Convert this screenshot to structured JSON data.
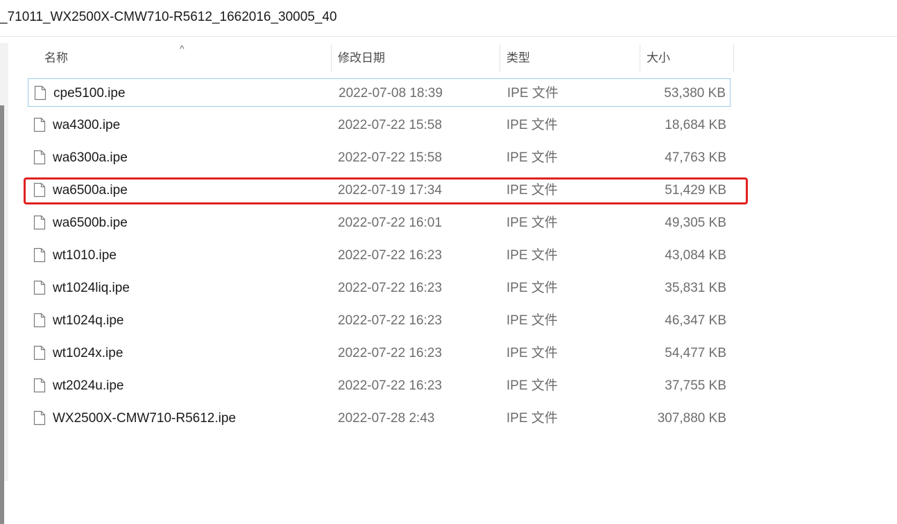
{
  "path": {
    "text": "_71011_WX2500X-CMW710-R5612_1662016_30005_40"
  },
  "columns": {
    "name": "名称",
    "date": "修改日期",
    "type": "类型",
    "size": "大小"
  },
  "sort_indicator": "^",
  "files": [
    {
      "name": "cpe5100.ipe",
      "date": "2022-07-08 18:39",
      "type": "IPE 文件",
      "size": "53,380 KB"
    },
    {
      "name": "wa4300.ipe",
      "date": "2022-07-22 15:58",
      "type": "IPE 文件",
      "size": "18,684 KB"
    },
    {
      "name": "wa6300a.ipe",
      "date": "2022-07-22 15:58",
      "type": "IPE 文件",
      "size": "47,763 KB"
    },
    {
      "name": "wa6500a.ipe",
      "date": "2022-07-19 17:34",
      "type": "IPE 文件",
      "size": "51,429 KB"
    },
    {
      "name": "wa6500b.ipe",
      "date": "2022-07-22 16:01",
      "type": "IPE 文件",
      "size": "49,305 KB"
    },
    {
      "name": "wt1010.ipe",
      "date": "2022-07-22 16:23",
      "type": "IPE 文件",
      "size": "43,084 KB"
    },
    {
      "name": "wt1024liq.ipe",
      "date": "2022-07-22 16:23",
      "type": "IPE 文件",
      "size": "35,831 KB"
    },
    {
      "name": "wt1024q.ipe",
      "date": "2022-07-22 16:23",
      "type": "IPE 文件",
      "size": "46,347 KB"
    },
    {
      "name": "wt1024x.ipe",
      "date": "2022-07-22 16:23",
      "type": "IPE 文件",
      "size": "54,477 KB"
    },
    {
      "name": "wt2024u.ipe",
      "date": "2022-07-22 16:23",
      "type": "IPE 文件",
      "size": "37,755 KB"
    },
    {
      "name": "WX2500X-CMW710-R5612.ipe",
      "date": "2022-07-28 2:43",
      "type": "IPE 文件",
      "size": "307,880 KB"
    }
  ],
  "selected_index": 0,
  "highlighted_index": 3,
  "colors": {
    "selection_border": "#99cce8",
    "highlight_box": "#e02020"
  }
}
